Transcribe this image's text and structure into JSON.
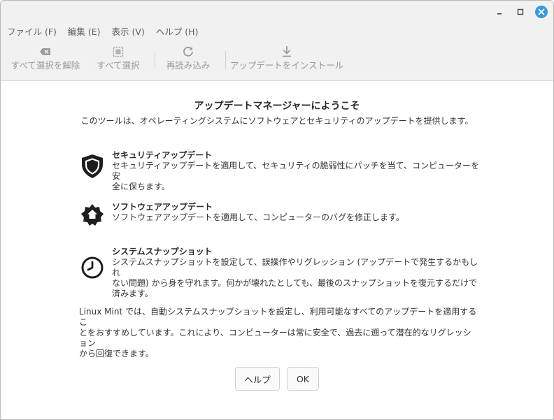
{
  "menu": [
    "ファイル (F)",
    "編集 (E)",
    "表示 (V)",
    "ヘルプ (H)"
  ],
  "toolbar": {
    "clear_selection": "すべて選択を解除",
    "select_all": "すべて選択",
    "refresh": "再読み込み",
    "install": "アップデートをインストール"
  },
  "welcome": {
    "title": "アップデートマネージャーにようこそ",
    "subtitle": "このツールは、オペレーティングシステムにソフトウェアとセキュリティのアップデートを提供します。",
    "features": [
      {
        "icon": "shield-icon",
        "title": "セキュリティアップデート",
        "line1": "セキュリティアップデートを適用して、セキュリティの脆弱性にパッチを当て、コンピューターを安",
        "line2": "全に保ちます。",
        "line3": ""
      },
      {
        "icon": "software-home-icon",
        "title": "ソフトウェアアップデート",
        "line1": "ソフトウェアアップデートを適用して、コンピューターのバグを修正します。",
        "line2": "",
        "line3": ""
      },
      {
        "icon": "clock-icon",
        "title": "システムスナップショット",
        "line1": "システムスナップショットを設定して、誤操作やリグレッション (アップデートで発生するかもしれ",
        "line2": "ない問題) から身を守れます。何かが壊れたとしても、最後のスナップショットを復元するだけで",
        "line3": "済みます。"
      }
    ],
    "note_line1": "Linux Mint では、自動システムスナップショットを設定し、利用可能なすべてのアップデートを適用するこ",
    "note_line2": "とをおすすめしています。これにより、コンピューターは常に安全で、過去に遡って潜在的なリグレッション",
    "note_line3": "から回復できます。"
  },
  "buttons": {
    "help": "ヘルプ",
    "ok": "OK"
  },
  "colors": {
    "close_button": "#3a9ad9",
    "toolbar_disabled": "#9a9a9a"
  }
}
